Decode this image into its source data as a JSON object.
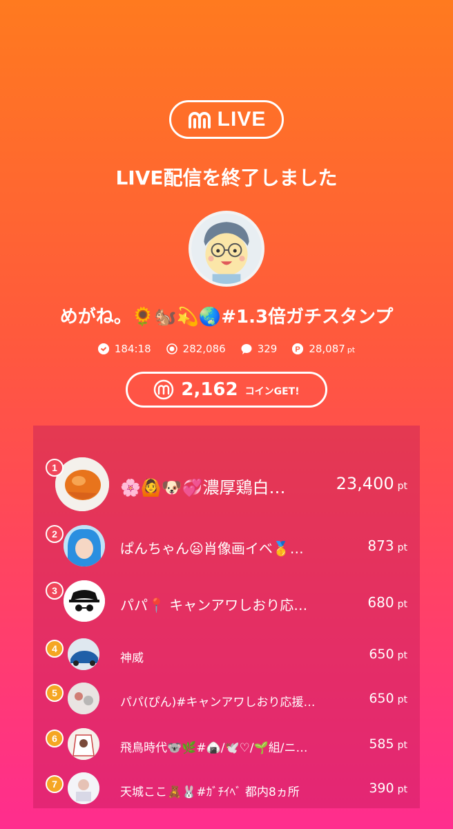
{
  "header": {
    "logo_text": "LIVE",
    "logo_icon": "mixchannel-m-icon"
  },
  "end_title": "LIVE配信を終了しました",
  "streamer": {
    "name": "めがね。🌻🐿️💫🌏#1.3倍ガチスタンプ"
  },
  "stats": {
    "duration": "184:18",
    "viewers": "282,086",
    "comments": "329",
    "points": "28,087",
    "points_unit": "pt"
  },
  "coins": {
    "amount": "2,162",
    "label": "コインGET!"
  },
  "ranking": [
    {
      "rank": "1",
      "name": "🌸🙆🐶💞濃厚鶏白…",
      "points": "23,400",
      "unit": "pt",
      "badge_color": "#F0455A"
    },
    {
      "rank": "2",
      "name": "ぱんちゃん😦肖像画イベ🥇…",
      "points": "873",
      "unit": "pt",
      "badge_color": "#F0455A"
    },
    {
      "rank": "3",
      "name": "パパ📍 キャンアワしおり応…",
      "points": "680",
      "unit": "pt",
      "badge_color": "#F0455A"
    },
    {
      "rank": "4",
      "name": "神威",
      "points": "650",
      "unit": "pt",
      "badge_color": "#F5A623"
    },
    {
      "rank": "5",
      "name": "パパ(ぴん)#キャンアワしおり応援…",
      "points": "650",
      "unit": "pt",
      "badge_color": "#F5A623"
    },
    {
      "rank": "6",
      "name": "飛鳥時代🐨🌿#🍙/🕊️♡/🌱組/ニ…",
      "points": "585",
      "unit": "pt",
      "badge_color": "#F5A623"
    },
    {
      "rank": "7",
      "name": "天城ここ🧸🐰#ｶﾞﾁｲﾍﾞ 都内8ヵ所",
      "points": "390",
      "unit": "pt",
      "badge_color": "#F5A623"
    }
  ]
}
